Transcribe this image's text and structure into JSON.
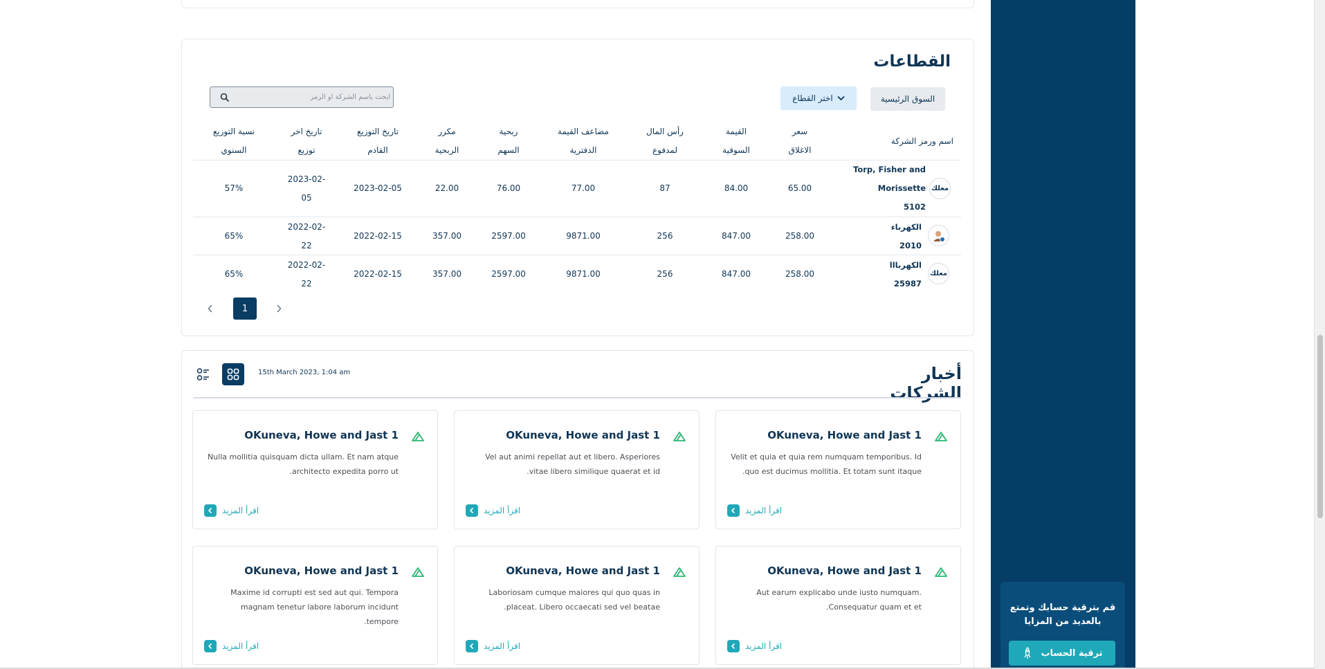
{
  "sectors": {
    "title": "القطاعات",
    "main_market_label": "السوق الرئيسية",
    "sector_select_label": "اختر القطاع",
    "search_placeholder": "ابحث باسم الشركة او الرمز",
    "headers": [
      [
        "اسم ورمز الشركة"
      ],
      [
        "سعر",
        "الاغلاق"
      ],
      [
        "القيمة",
        "السوقية"
      ],
      [
        "رأس المال",
        "لمدفوع"
      ],
      [
        "مضاعف القيمة",
        "الدفترية"
      ],
      [
        "ربحية",
        "السهم"
      ],
      [
        "مكرر",
        "الربحية"
      ],
      [
        "تاريخ التوزيع",
        "القادم"
      ],
      [
        "تاريخ اخر",
        "توزيع"
      ],
      [
        "نسبة التوزيع",
        "السنوي"
      ]
    ],
    "rows": [
      {
        "company_lines": [
          "Torp, Fisher and",
          "Morissette",
          "5102"
        ],
        "logo": "معلك",
        "close_price": "65.00",
        "market_value": "84.00",
        "paid_capital": "87",
        "book_multiplier": "77.00",
        "eps": "76.00",
        "pe": "22.00",
        "next_dist": "2023-02-05",
        "last_dist_lines": [
          "2023-02-",
          "05"
        ],
        "annual_ratio": "57%"
      },
      {
        "company_lines": [
          "الكهرباء",
          "2010"
        ],
        "logo": "avatar",
        "close_price": "258.00",
        "market_value": "847.00",
        "paid_capital": "256",
        "book_multiplier": "9871.00",
        "eps": "2597.00",
        "pe": "357.00",
        "next_dist": "2022-02-15",
        "last_dist_lines": [
          "2022-02-",
          "22"
        ],
        "annual_ratio": "65%"
      },
      {
        "company_lines": [
          "الكهربااا",
          "25987"
        ],
        "logo": "معلك",
        "close_price": "258.00",
        "market_value": "847.00",
        "paid_capital": "256",
        "book_multiplier": "9871.00",
        "eps": "2597.00",
        "pe": "357.00",
        "next_dist": "2022-02-15",
        "last_dist_lines": [
          "2022-02-",
          "22"
        ],
        "annual_ratio": "65%"
      }
    ],
    "pagination": {
      "current": "1"
    }
  },
  "news": {
    "title": "أخبار الشركات",
    "date": "15th March 2023, 1:04 am",
    "read_more_label": "اقرأ المزيد",
    "items": [
      {
        "title": "OKuneva, Howe and Jast 1",
        "text": "Velit et quia et quia rem numquam temporibus. Id quo est ducimus mollitia. Et totam sunt itaque."
      },
      {
        "title": "OKuneva, Howe and Jast 1",
        "text": "Vel aut animi repellat aut et libero. Asperiores vitae libero similique quaerat et id."
      },
      {
        "title": "OKuneva, Howe and Jast 1",
        "text": "Nulla mollitia quisquam dicta ullam. Et nam atque architecto expedita porro ut."
      },
      {
        "title": "OKuneva, Howe and Jast 1",
        "text": "Aut earum explicabo unde iusto numquam. Consequatur quam et et."
      },
      {
        "title": "OKuneva, Howe and Jast 1",
        "text": "Laboriosam cumque maiores qui quo quas in placeat. Libero occaecati sed vel beatae."
      },
      {
        "title": "OKuneva, Howe and Jast 1",
        "text": "Maxime id corrupti est sed aut qui. Tempora magnam tenetur labore laborum incidunt tempore."
      }
    ]
  },
  "sidebar": {
    "upgrade_text_line1": "قم بترقية حسابك وتمتع",
    "upgrade_text_line2": "بالعديد من المزايا",
    "upgrade_button": "ترقية الحساب"
  },
  "colors": {
    "navy": "#063d66",
    "teal": "#1fa8b8",
    "text": "#0f3555",
    "news_logo_green": "#2bb673"
  }
}
